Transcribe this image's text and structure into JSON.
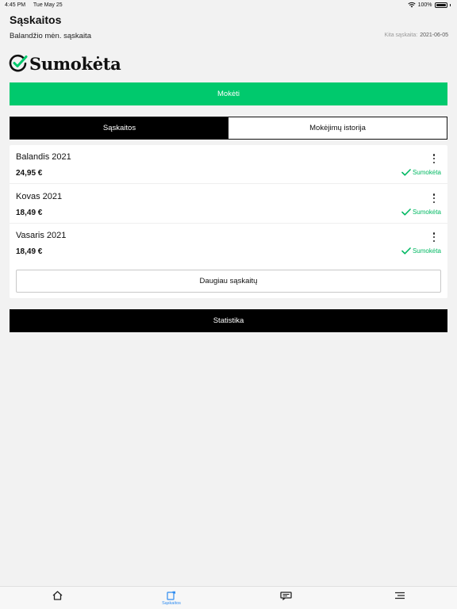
{
  "status_bar": {
    "time": "4:45 PM",
    "date": "Tue May 25",
    "battery": "100%"
  },
  "header": {
    "title": "Sąskaitos",
    "subtitle": "Balandžio mėn. sąskaita",
    "next_bill_label": "Kita sąskaita:",
    "next_bill_date": "2021-06-05"
  },
  "banner": {
    "text": "Sumokėta",
    "icon": "check-circle-icon"
  },
  "actions": {
    "pay_label": "Mokėti",
    "more_label": "Daugiau sąskaitų",
    "stats_label": "Statistika"
  },
  "tabs": [
    {
      "label": "Sąskaitos",
      "active": true
    },
    {
      "label": "Mokėjimų istorija",
      "active": false
    }
  ],
  "bills": [
    {
      "month": "Balandis 2021",
      "amount": "24,95 €",
      "status": "Sumokėta"
    },
    {
      "month": "Kovas 2021",
      "amount": "18,49 €",
      "status": "Sumokėta"
    },
    {
      "month": "Vasaris 2021",
      "amount": "18,49 €",
      "status": "Sumokėta"
    }
  ],
  "bottom_nav": [
    {
      "icon": "home-icon",
      "label": ""
    },
    {
      "icon": "bills-icon",
      "label": "Sąskaitos"
    },
    {
      "icon": "ticket-icon",
      "label": ""
    },
    {
      "icon": "menu-icon",
      "label": ""
    }
  ],
  "colors": {
    "accent_green": "#00c96d",
    "status_green": "#00b862",
    "nav_active": "#2f8cf0"
  }
}
